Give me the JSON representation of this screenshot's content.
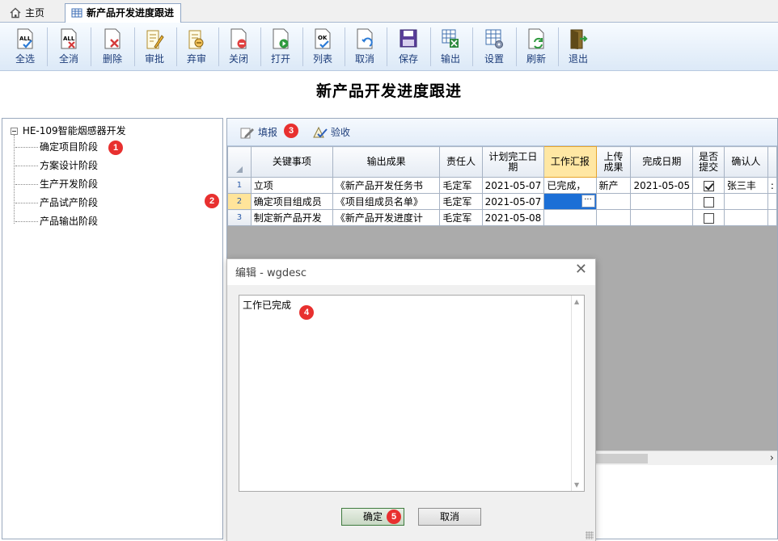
{
  "tabs": [
    {
      "label": "主页",
      "icon": "home-icon"
    },
    {
      "label": "新产品开发进度跟进",
      "icon": "grid-icon"
    }
  ],
  "toolbar": [
    {
      "label": "全选",
      "icon": "select-all-icon"
    },
    {
      "label": "全消",
      "icon": "deselect-all-icon"
    },
    {
      "label": "删除",
      "icon": "delete-icon"
    },
    {
      "label": "审批",
      "icon": "approve-icon"
    },
    {
      "label": "弃审",
      "icon": "unapprove-icon"
    },
    {
      "label": "关闭",
      "icon": "close-doc-icon"
    },
    {
      "label": "打开",
      "icon": "open-doc-icon"
    },
    {
      "label": "列表",
      "icon": "list-icon"
    },
    {
      "label": "取消",
      "icon": "undo-icon"
    },
    {
      "label": "保存",
      "icon": "save-icon"
    },
    {
      "label": "输出",
      "icon": "export-icon"
    },
    {
      "label": "设置",
      "icon": "settings-icon"
    },
    {
      "label": "刷新",
      "icon": "refresh-icon"
    },
    {
      "label": "退出",
      "icon": "exit-icon"
    }
  ],
  "page_title": "新产品开发进度跟进",
  "tree": {
    "root": "HE-109智能烟感器开发",
    "items": [
      "确定项目阶段",
      "方案设计阶段",
      "生产开发阶段",
      "产品试产阶段",
      "产品输出阶段"
    ]
  },
  "subbar": {
    "fill_label": "填报",
    "accept_label": "验收"
  },
  "grid": {
    "columns": [
      "关键事项",
      "输出成果",
      "责任人",
      "计划完工日期",
      "工作汇报",
      "上传成果",
      "完成日期",
      "是否提交",
      "确认人"
    ],
    "rows": [
      {
        "no": "1",
        "item": "立项",
        "output": "《新产品开发任务书",
        "owner": "毛定军",
        "plan": "2021-05-07",
        "report": "已完成，",
        "upload": "新产",
        "done": "2021-05-05",
        "submitted": true,
        "confirm": "张三丰"
      },
      {
        "no": "2",
        "item": "确定项目组成员",
        "output": "《项目组成员名单》",
        "owner": "毛定军",
        "plan": "2021-05-07",
        "report": "",
        "upload": "",
        "done": "",
        "submitted": false,
        "confirm": ""
      },
      {
        "no": "3",
        "item": "制定新产品开发",
        "output": "《新产品开发进度计",
        "owner": "毛定军",
        "plan": "2021-05-08",
        "report": "",
        "upload": "",
        "done": "",
        "submitted": false,
        "confirm": ""
      }
    ],
    "ellipsis": "···"
  },
  "dialog": {
    "title": "编辑 - wgdesc",
    "text": "工作已完成",
    "ok_label": "确定",
    "cancel_label": "取消"
  },
  "badges": [
    "1",
    "2",
    "3",
    "4",
    "5"
  ],
  "colors": {
    "accent": "#1c6fd6",
    "badge": "#e8302f",
    "header_selected": "#ffe7a3"
  }
}
